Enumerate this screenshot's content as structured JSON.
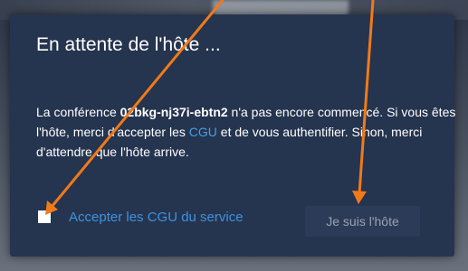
{
  "dialog": {
    "title": "En attente de l'hôte ...",
    "message_prefix": "La conférence ",
    "conference_id": "02bkg-nj37i-ebtn2",
    "message_middle": " n'a pas encore commencé. Si vous êtes l'hôte, merci d'accepter les ",
    "terms_link": "CGU",
    "message_suffix": " et de vous authentifier. Sinon, merci d'attendre que l'hôte arrive.",
    "accept_terms_label": "Accepter les CGU du service",
    "accept_terms_checked": false,
    "host_button_label": "Je suis l'hôte"
  },
  "colors": {
    "dialog_background": "#25344f",
    "link": "#4a9ee8",
    "annotation_arrow": "#f07a1a",
    "button_background": "#2c3b58"
  },
  "annotations": {
    "arrow_count": 2,
    "arrow_icon": "orange-arrow-icon"
  }
}
